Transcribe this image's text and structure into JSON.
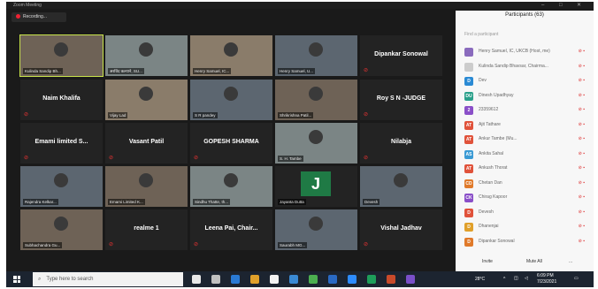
{
  "window": {
    "title": "Zoom Meeting",
    "controls": [
      "–",
      "□",
      "✕"
    ]
  },
  "recording": {
    "label": "Recording..."
  },
  "tiles": [
    {
      "kind": "photo",
      "caption": "Kulinda Sandip Bh...",
      "active": true
    },
    {
      "kind": "photo",
      "caption": "अरविंद कल्याने, SU..."
    },
    {
      "kind": "photo",
      "caption": "Henry Samuel, IC..."
    },
    {
      "kind": "photo",
      "caption": "Henry Samuel, U..."
    },
    {
      "kind": "name",
      "name": "Dipankar Sonowal"
    },
    {
      "kind": "name",
      "name": "Naim Khalifa"
    },
    {
      "kind": "photo",
      "caption": "Vijay Lad"
    },
    {
      "kind": "photo",
      "caption": "S R pandey"
    },
    {
      "kind": "photo",
      "caption": "Shrikrishna Patil..."
    },
    {
      "kind": "name",
      "name": "Roy S N -JUDGE"
    },
    {
      "kind": "name",
      "name": "Emami limited S..."
    },
    {
      "kind": "name",
      "name": "Vasant Patil"
    },
    {
      "kind": "name",
      "name": "GOPESH SHARMA"
    },
    {
      "kind": "photo",
      "caption": "S. H. Tambe"
    },
    {
      "kind": "name",
      "name": "Nilabja"
    },
    {
      "kind": "photo",
      "caption": "Rajendra Kelkar..."
    },
    {
      "kind": "photo",
      "caption": "Emami Limited K..."
    },
    {
      "kind": "photo",
      "caption": "Sindhu Thatte, th..."
    },
    {
      "kind": "letter",
      "letter": "J",
      "caption": "Jayanta Dutta"
    },
    {
      "kind": "photo",
      "caption": "Devesh"
    },
    {
      "kind": "photo",
      "caption": "Subhachandra Gu..."
    },
    {
      "kind": "name",
      "name": "realme 1"
    },
    {
      "kind": "name",
      "name": "Leena Pai, Chair..."
    },
    {
      "kind": "photo",
      "caption": "Saurabh MG..."
    },
    {
      "kind": "name",
      "name": "Vishal Jadhav"
    }
  ],
  "participants": {
    "title": "Participants (63)",
    "search_placeholder": "Find a participant",
    "rows": [
      {
        "initials": "",
        "name": "Henry Samuel, IC, UKCB (Host, me)",
        "color": "#8a6bbd"
      },
      {
        "initials": "",
        "name": "Kulinda Sandip Bhavsar, Chairma...",
        "color": "#cccccc"
      },
      {
        "initials": "D",
        "name": "Dev",
        "color": "#2a8ad4"
      },
      {
        "initials": "DU",
        "name": "Dinesh Upadhyay",
        "color": "#2aa08a"
      },
      {
        "initials": "2",
        "name": "23359612",
        "color": "#8a4fc8"
      },
      {
        "initials": "AT",
        "name": "Ajit Tathare",
        "color": "#e0523a"
      },
      {
        "initials": "AT",
        "name": "Ankur Tambe (Mu...",
        "color": "#e0523a"
      },
      {
        "initials": "AS",
        "name": "Ankita Sahal",
        "color": "#3a9ad4"
      },
      {
        "initials": "AT",
        "name": "Ankush Thorat",
        "color": "#e0523a"
      },
      {
        "initials": "CD",
        "name": "Chetan Dan",
        "color": "#e07a2a"
      },
      {
        "initials": "CK",
        "name": "Chirag Kapoor",
        "color": "#8a4fc8"
      },
      {
        "initials": "D",
        "name": "Devesh",
        "color": "#e0523a"
      },
      {
        "initials": "D",
        "name": "Dhanenjai",
        "color": "#e0a02a"
      },
      {
        "initials": "D",
        "name": "Dipankar Sonowal",
        "color": "#e07a2a"
      }
    ],
    "footer": {
      "invite": "Invite",
      "mute_all": "Mute All",
      "more": "..."
    }
  },
  "taskbar": {
    "search_placeholder": "Type here to search",
    "weather": "28°C",
    "time": "6:09 PM",
    "date": "7/23/2021"
  },
  "colors": {
    "active_speaker": "#c8e34a",
    "jayanta_avatar": "#1f7a45",
    "taskbar": "#1c2430"
  }
}
